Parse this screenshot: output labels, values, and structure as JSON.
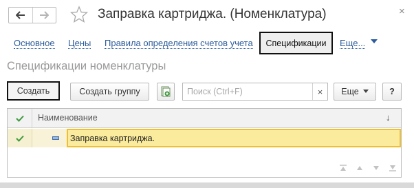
{
  "header": {
    "title": "Заправка картриджа. (Номенклатура)",
    "back_icon": "arrow-left-icon",
    "forward_icon": "arrow-right-icon",
    "favorite_icon": "star-outline-icon",
    "close_glyph": "×"
  },
  "tabs": {
    "items": [
      {
        "label": "Основное"
      },
      {
        "label": "Цены"
      },
      {
        "label": "Правила определения счетов учета"
      },
      {
        "label": "Спецификации",
        "active": true
      },
      {
        "label": "Еще..."
      }
    ]
  },
  "section": {
    "title": "Спецификации номенклатуры"
  },
  "toolbar": {
    "create_label": "Создать",
    "create_group_label": "Создать группу",
    "copy_icon": "copy-document-icon",
    "search_placeholder": "Поиск (Ctrl+F)",
    "search_clear": "×",
    "more_label": "Еще",
    "help_label": "?"
  },
  "table": {
    "columns": [
      "Наименование"
    ],
    "sort_glyph": "↓",
    "rows": [
      {
        "checked": true,
        "name": "Заправка картриджа."
      }
    ]
  },
  "colors": {
    "link": "#2a5b9a",
    "selected_row": "#fbeb9c",
    "selected_border": "#eebf34",
    "check_green": "#3c9a3c"
  }
}
